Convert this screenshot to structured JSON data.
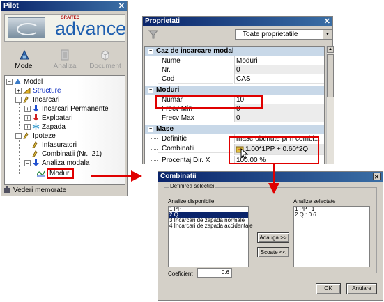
{
  "pilot": {
    "title": "Pilot",
    "logo_brand": "GRAITEC",
    "logo_name": "advance",
    "modes": [
      {
        "label": "Model",
        "icon": "model-icon",
        "enabled": true
      },
      {
        "label": "Analiza",
        "icon": "analysis-icon",
        "enabled": false
      },
      {
        "label": "Document",
        "icon": "document-icon",
        "enabled": false
      }
    ],
    "tree": {
      "model": "Model",
      "structure": "Structure",
      "incarcari": "Incarcari",
      "incarcari_permanente": "Incarcari Permanente",
      "exploatari": "Exploatari",
      "zapada": "Zapada",
      "ipoteze": "Ipoteze",
      "infasuratori": "Infasuratori",
      "combinatii": "Combinatii (Nr.: 21)",
      "analiza_modala": "Analiza modala",
      "moduri": "Moduri"
    },
    "bottom_item": "Vederi memorate"
  },
  "props": {
    "title": "Proprietati",
    "filter_value": "Toate proprietatile",
    "sections": {
      "caz": "Caz de incarcare modal",
      "moduri": "Moduri",
      "mase": "Mase"
    },
    "rows": {
      "nume": {
        "name": "Nume",
        "value": "Moduri"
      },
      "nr": {
        "name": "Nr.",
        "value": "0"
      },
      "cod": {
        "name": "Cod",
        "value": "CAS"
      },
      "numar": {
        "name": "Numar",
        "value": "10"
      },
      "frecv_min": {
        "name": "Frecv Min",
        "value": "0"
      },
      "frecv_max": {
        "name": "Frecv Max",
        "value": "0"
      },
      "definitie": {
        "name": "Definitie",
        "value": "mase obtinute prin combi..."
      },
      "combinatii": {
        "name": "Combinatii",
        "value": "1.00*1PP + 0.60*2Q"
      },
      "procentaj": {
        "name": "Procentaj Dir. X",
        "value": "100.00 %"
      }
    }
  },
  "combi": {
    "title": "Combinatii",
    "group_title": "Definirea selectiei",
    "available_label": "Analize disponibile",
    "selected_label": "Analize selectate",
    "available": [
      "1 PP",
      "2 Q",
      "3 Incarcari de zapada normale",
      "4 Incarcari de zapada accidentale"
    ],
    "available_selected_index": 1,
    "selected": [
      "1 PP : 1",
      "2 Q : 0.6"
    ],
    "add_button": "Adauga >>",
    "remove_button": "Scoate <<",
    "coef_label": "Coeficient",
    "coef_value": "0.6",
    "ok_button": "OK",
    "cancel_button": "Anulare"
  },
  "colors": {
    "highlight": "#e00000",
    "title_blue": "#0a246a",
    "tree_link_blue": "#1030c0"
  }
}
